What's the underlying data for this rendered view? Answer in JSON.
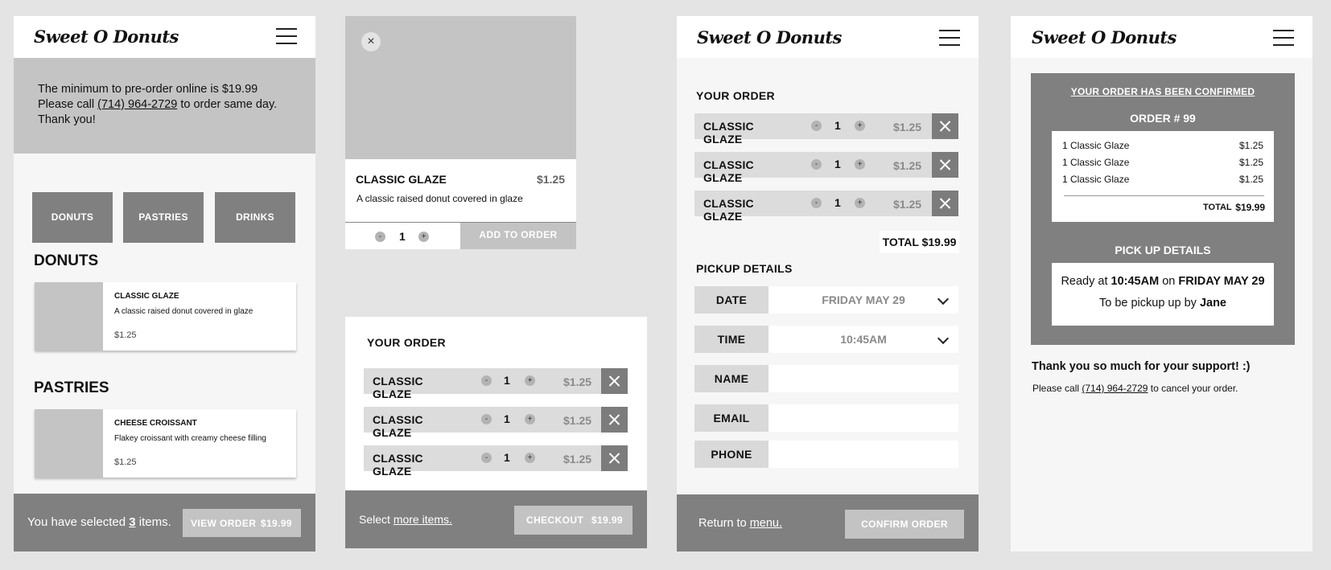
{
  "brand": "Sweet O Donuts",
  "menu": {
    "notice": {
      "line1": "The minimum to pre-order online is $19.99",
      "line2_pre": "Please call",
      "phone": "(714) 964-2729",
      "line2_post": "to order same day.",
      "line3": "Thank you!"
    },
    "categories": [
      "DONUTS",
      "PASTRIES",
      "DRINKS"
    ],
    "sections": [
      {
        "title": "DONUTS",
        "item": {
          "name": "CLASSIC GLAZE",
          "desc": "A classic raised donut covered in glaze",
          "price": "$1.25"
        }
      },
      {
        "title": "PASTRIES",
        "item": {
          "name": "CHEESE CROISSANT",
          "desc": "Flakey croissant with creamy cheese filling",
          "price": "$1.25"
        }
      }
    ],
    "footer": {
      "pre": "You have selected",
      "count": "3",
      "post": "items.",
      "button": "VIEW ORDER",
      "total": "$19.99"
    }
  },
  "detail": {
    "close": "×",
    "name": "CLASSIC GLAZE",
    "price": "$1.25",
    "desc": "A classic raised donut covered in glaze",
    "minus": "-",
    "qty": "1",
    "plus": "+",
    "add_button": "ADD TO ORDER"
  },
  "order_rows": [
    {
      "name": "CLASSIC GLAZE",
      "minus": "-",
      "qty": "1",
      "plus": "+",
      "price": "$1.25"
    },
    {
      "name": "CLASSIC GLAZE",
      "minus": "-",
      "qty": "1",
      "plus": "+",
      "price": "$1.25"
    },
    {
      "name": "CLASSIC GLAZE",
      "minus": "-",
      "qty": "1",
      "plus": "+",
      "price": "$1.25"
    }
  ],
  "cart": {
    "title": "YOUR ORDER",
    "footer": {
      "pre": "Select",
      "link": "more items.",
      "button": "CHECKOUT",
      "total": "$19.99"
    }
  },
  "checkout": {
    "title": "YOUR ORDER",
    "total": "TOTAL $19.99",
    "pickup_title": "PICKUP DETAILS",
    "fields": {
      "date_label": "DATE",
      "date_value": "FRIDAY MAY 29",
      "time_label": "TIME",
      "time_value": "10:45AM",
      "name_label": "NAME",
      "email_label": "EMAIL",
      "phone_label": "PHONE"
    },
    "footer": {
      "pre": "Return to",
      "link": "menu.",
      "button": "CONFIRM ORDER"
    }
  },
  "confirm": {
    "confirmed": "YOUR ORDER HAS BEEN CONFIRMED",
    "order_number": "ORDER # 99",
    "items": [
      {
        "name": "1 Classic Glaze",
        "price": "$1.25"
      },
      {
        "name": "1 Classic Glaze",
        "price": "$1.25"
      },
      {
        "name": "1 Classic Glaze",
        "price": "$1.25"
      }
    ],
    "total_label": "TOTAL",
    "total": "$19.99",
    "pickup_title": "PICK UP DETAILS",
    "ready_pre": "Ready at",
    "ready_time": "10:45AM",
    "ready_on": "on",
    "ready_day": "FRIDAY MAY 29",
    "by_pre": "To be pickup up by",
    "by_name": "Jane",
    "thanks": "Thank you so much for your support! :)",
    "cancel_pre": "Please call",
    "cancel_phone": "(714) 964-2729",
    "cancel_post": "to cancel your order."
  }
}
